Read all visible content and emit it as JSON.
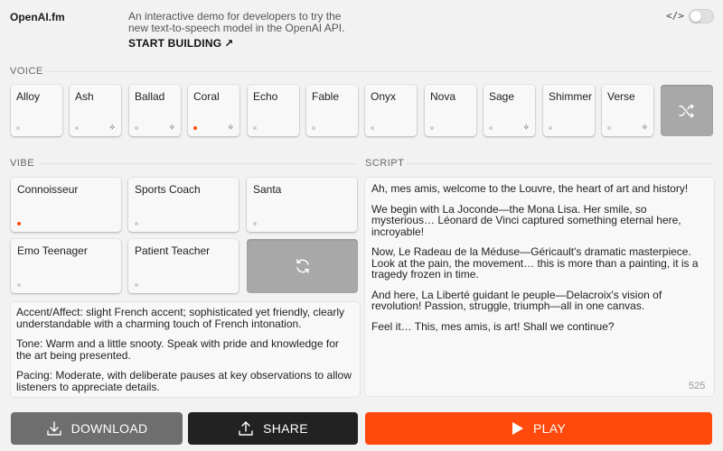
{
  "header": {
    "logo": "OpenAI.fm",
    "tagline": "An interactive demo for developers to try the new text-to-speech model in the OpenAI API.",
    "start_label": "START BUILDING",
    "start_arrow": "↗",
    "code_icon": "</>"
  },
  "voice": {
    "label": "VOICE",
    "items": [
      {
        "name": "Alloy",
        "active": false,
        "sparkle": false
      },
      {
        "name": "Ash",
        "active": false,
        "sparkle": true
      },
      {
        "name": "Ballad",
        "active": false,
        "sparkle": true
      },
      {
        "name": "Coral",
        "active": true,
        "sparkle": true
      },
      {
        "name": "Echo",
        "active": false,
        "sparkle": false
      },
      {
        "name": "Fable",
        "active": false,
        "sparkle": false
      },
      {
        "name": "Onyx",
        "active": false,
        "sparkle": false
      },
      {
        "name": "Nova",
        "active": false,
        "sparkle": false
      },
      {
        "name": "Sage",
        "active": false,
        "sparkle": true
      },
      {
        "name": "Shimmer",
        "active": false,
        "sparkle": false
      },
      {
        "name": "Verse",
        "active": false,
        "sparkle": true
      }
    ]
  },
  "vibe": {
    "label": "VIBE",
    "items": [
      {
        "name": "Connoisseur",
        "active": true
      },
      {
        "name": "Sports Coach",
        "active": false
      },
      {
        "name": "Santa",
        "active": false
      },
      {
        "name": "Emo Teenager",
        "active": false
      },
      {
        "name": "Patient Teacher",
        "active": false
      }
    ],
    "description": [
      "Accent/Affect: slight French accent; sophisticated yet friendly, clearly understandable with a charming touch of French intonation.",
      "Tone: Warm and a little snooty. Speak with pride and knowledge for the art being presented.",
      "Pacing: Moderate, with deliberate pauses at key observations to allow listeners to appreciate details."
    ]
  },
  "script": {
    "label": "SCRIPT",
    "paragraphs": [
      "Ah, mes amis, welcome to the Louvre, the heart of art and history!",
      "We begin with La Joconde—the Mona Lisa. Her smile, so mysterious… Léonard de Vinci captured something eternal here, incroyable!",
      "Now, Le Radeau de la Méduse—Géricault's dramatic masterpiece. Look at the pain, the movement… this is more than a painting, it is a tragedy frozen in time.",
      "And here, La Liberté guidant le peuple—Delacroix's vision of revolution! Passion, struggle, triumph—all in one canvas.",
      "Feel it… This, mes amis, is art! Shall we continue?"
    ],
    "char_count": "525"
  },
  "actions": {
    "download": "DOWNLOAD",
    "share": "SHARE",
    "play": "PLAY"
  },
  "colors": {
    "accent": "#ff4a0d",
    "dark": "#222222",
    "gray_button": "#6e6e6e"
  }
}
